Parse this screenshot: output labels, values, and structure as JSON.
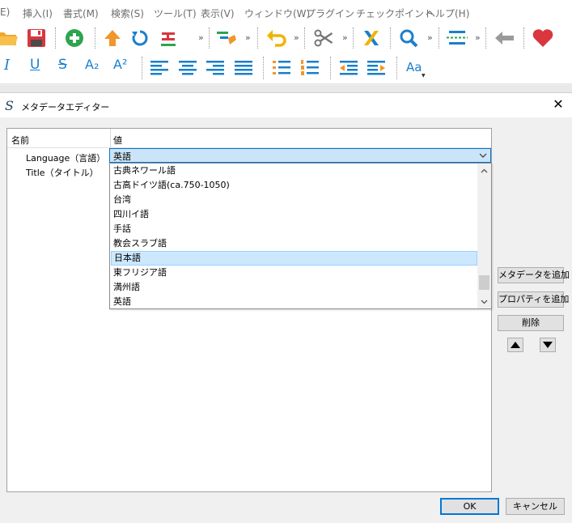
{
  "menubar": {
    "items": [
      "E)",
      "挿入(I)",
      "書式(M)",
      "検索(S)",
      "ツール(T)",
      "表示(V)",
      "ウィンドウ(W)",
      "プラグイン",
      "チェックポイント",
      "ヘルプ(H)"
    ]
  },
  "toolbar": {
    "more": "»",
    "format_glyphs": {
      "italic": "I",
      "underline": "U",
      "strike": "S",
      "subscript": "A₂",
      "superscript": "A²",
      "font": "Aa"
    }
  },
  "dialog": {
    "title": "メタデータエディター",
    "close": "✕",
    "grid": {
      "col_name": "名前",
      "col_value": "値",
      "rows": [
        {
          "label": "Language（言語）"
        },
        {
          "label": "Title（タイトル）"
        }
      ]
    },
    "combo_value": "英語",
    "dropdown": {
      "items": [
        "古典ネワール語",
        "古高ドイツ語(ca.750-1050)",
        "台湾",
        "四川イ語",
        "手話",
        "教会スラブ語",
        "日本語",
        "東フリジア語",
        "満州語",
        "英語"
      ],
      "selected_index": 6
    },
    "buttons": {
      "add_metadata": "メタデータを追加",
      "add_property": "プロパティを追加",
      "delete": "削除",
      "ok": "OK",
      "cancel": "キャンセル"
    }
  },
  "colors": {
    "accent": "#0078d7",
    "selection": "#cce8ff",
    "icon_blue": "#1a7fcc",
    "icon_green": "#2ea44f",
    "icon_orange": "#f0962c",
    "icon_red": "#d9363e"
  }
}
